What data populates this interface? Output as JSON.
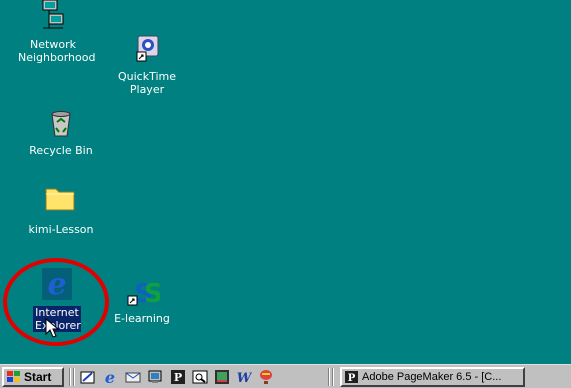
{
  "desktop": {
    "icons": [
      {
        "label": "Network Neighborhood",
        "icon": "network-neighborhood-icon"
      },
      {
        "label": "QuickTime Player",
        "icon": "quicktime-player-icon"
      },
      {
        "label": "Recycle Bin",
        "icon": "recycle-bin-icon"
      },
      {
        "label": "kimi-Lesson",
        "icon": "folder-icon"
      },
      {
        "label": "Internet Explorer",
        "icon": "internet-explorer-icon",
        "selected": true
      },
      {
        "label": "E-learning",
        "icon": "e-learning-icon"
      }
    ],
    "annotation_color": "#e00000"
  },
  "taskbar": {
    "start_label": "Start",
    "quick_launch": [
      "show-desktop-icon",
      "internet-explorer-icon",
      "outlook-express-icon",
      "channels-icon",
      "pagemaker-icon",
      "browser-icon",
      "image-editor-icon",
      "word-icon",
      "balloon-icon"
    ],
    "task_button_label": "Adobe PageMaker 6.5 - [C..."
  },
  "colors": {
    "desktop": "#008080",
    "taskbar": "#c0c0c0",
    "selection": "#0a246a"
  }
}
